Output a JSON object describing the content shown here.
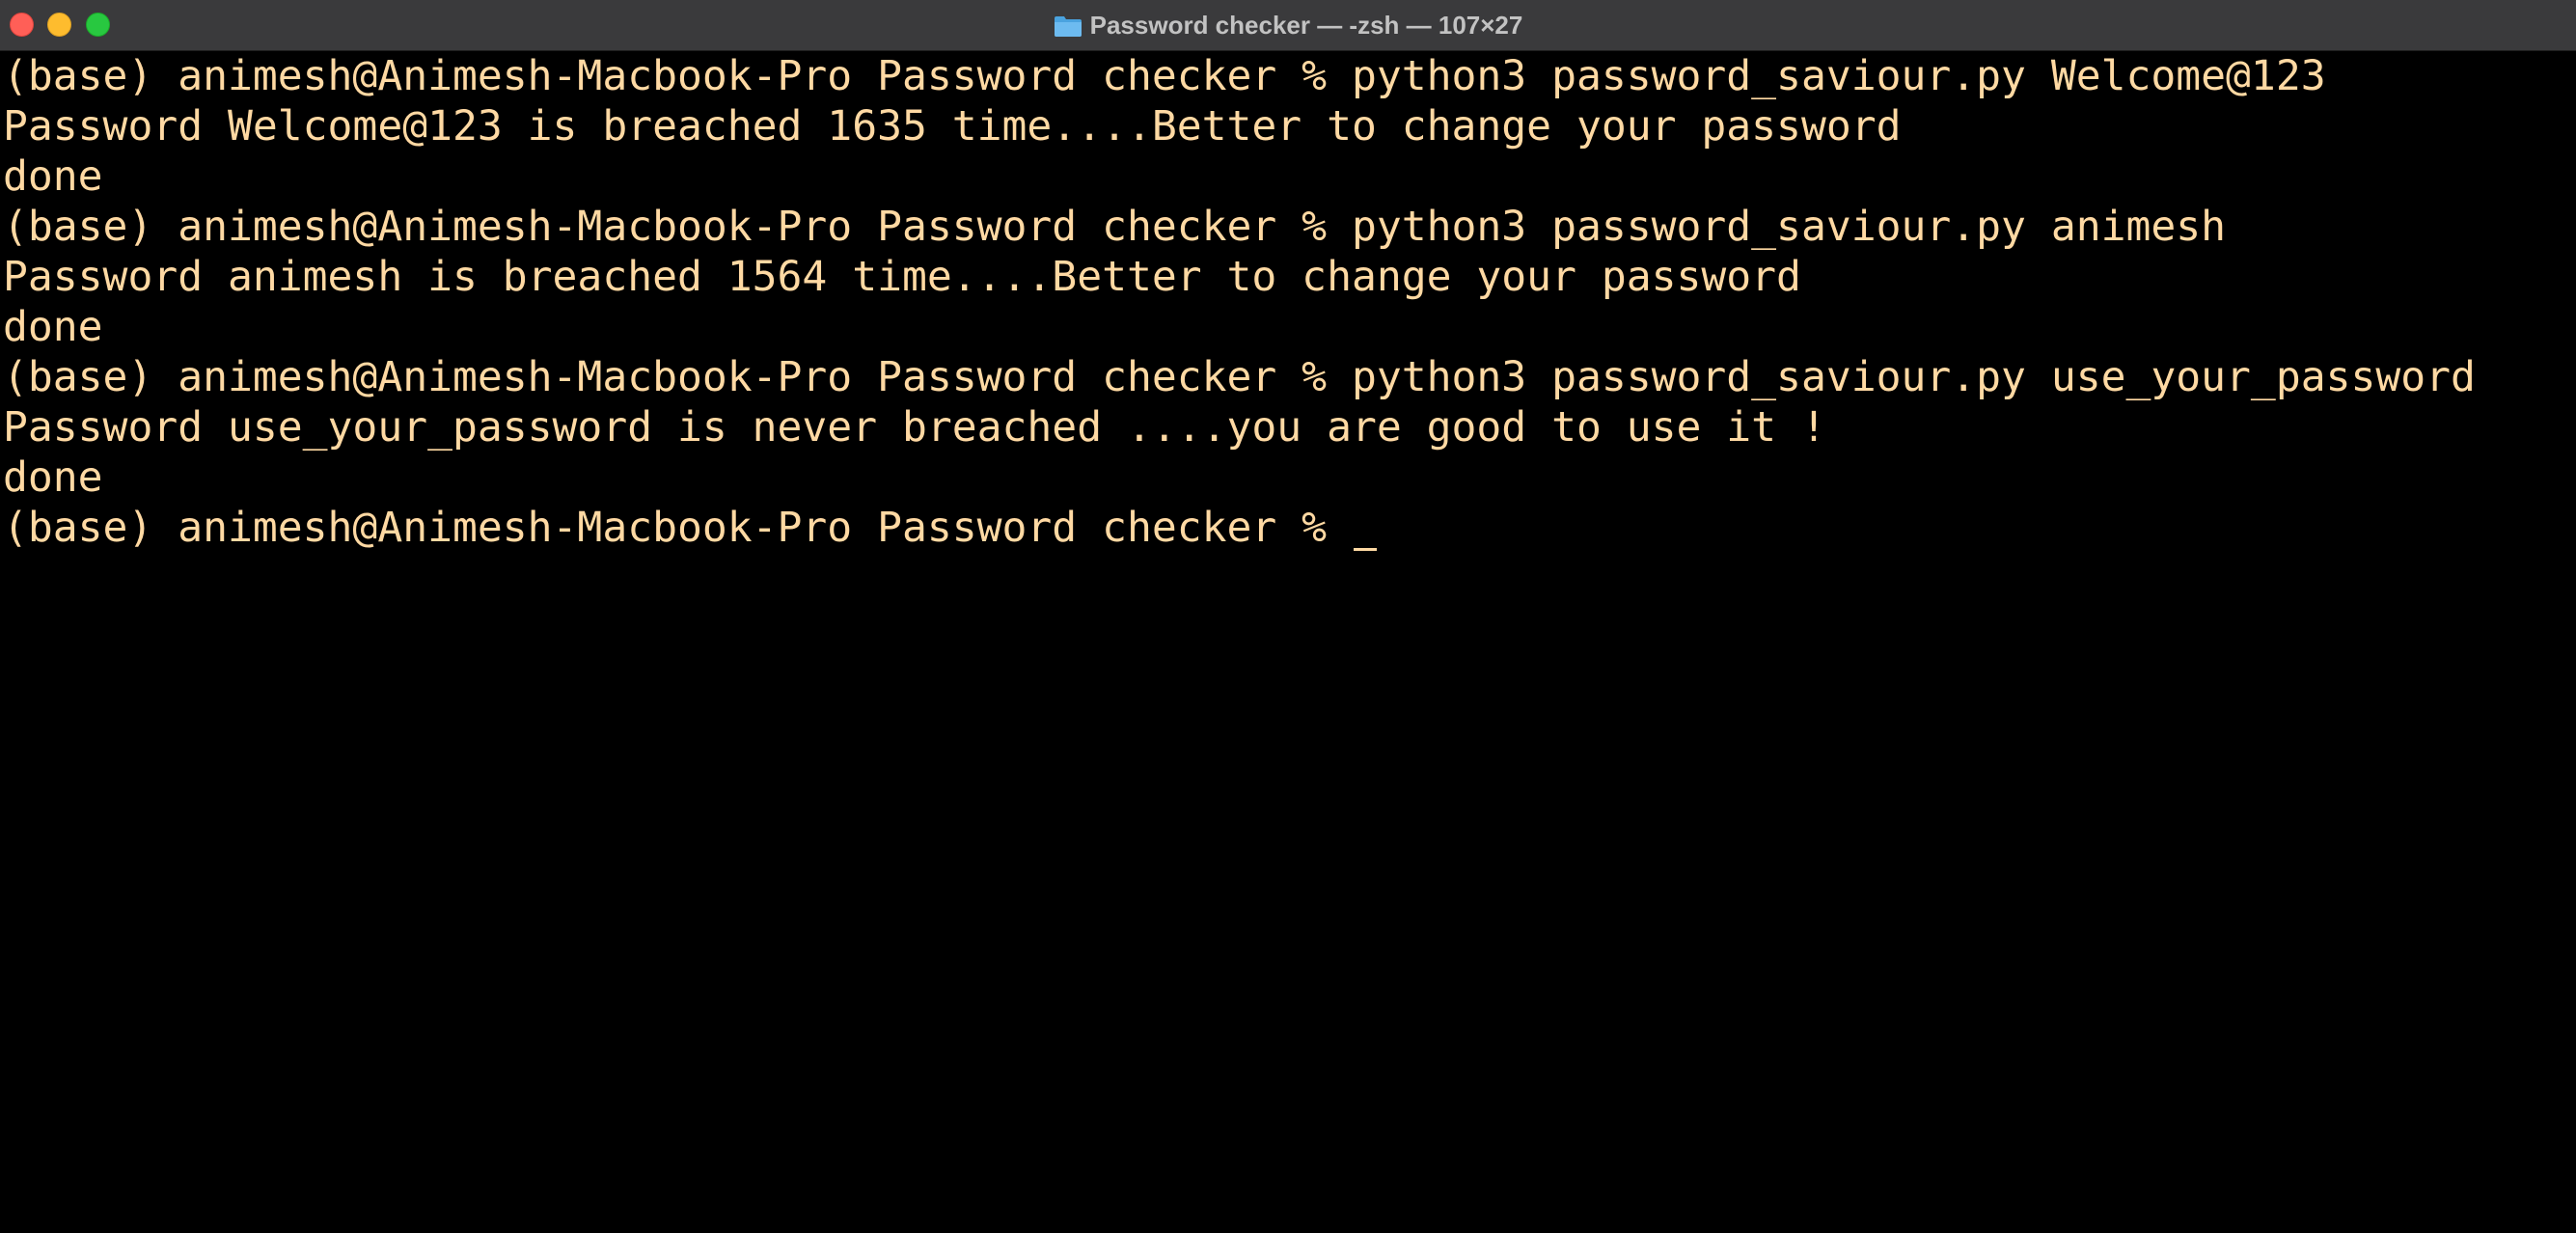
{
  "window": {
    "title": "Password checker — -zsh — 107×27",
    "folder_icon": "folder-icon"
  },
  "colors": {
    "background": "#000000",
    "text": "#ffd9a3",
    "titlebar": "#3a3a3c",
    "close": "#ff5f57",
    "minimize": "#febc2e",
    "zoom": "#28c840"
  },
  "terminal": {
    "lines": [
      "(base) animesh@Animesh-Macbook-Pro Password checker % python3 password_saviour.py Welcome@123",
      "Password Welcome@123 is breached 1635 time....Better to change your password",
      "done",
      "(base) animesh@Animesh-Macbook-Pro Password checker % python3 password_saviour.py animesh",
      "Password animesh is breached 1564 time....Better to change your password",
      "done",
      "(base) animesh@Animesh-Macbook-Pro Password checker % python3 password_saviour.py use_your_password",
      "Password use_your_password is never breached ....you are good to use it !",
      "done"
    ],
    "prompt": "(base) animesh@Animesh-Macbook-Pro Password checker % "
  }
}
